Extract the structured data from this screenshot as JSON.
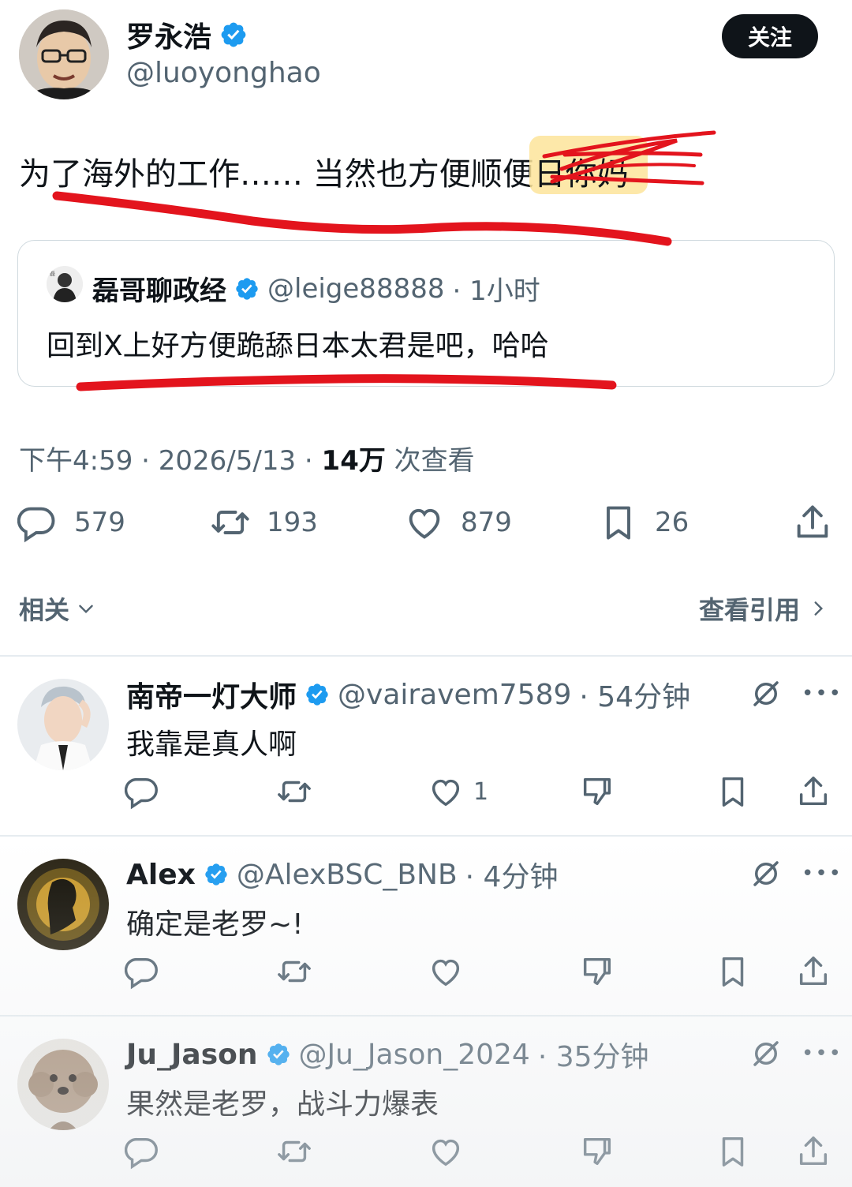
{
  "post": {
    "author_name": "罗永浩",
    "author_handle": "@luoyonghao",
    "follow_label": "关注",
    "text_main": "为了海外的工作…… 当然也方便顺便",
    "text_struck": "日你妈",
    "quote": {
      "name": "磊哥聊政经",
      "handle": "@leige88888",
      "time": "· 1小时",
      "text": "回到X上好方便跪舔日本太君是吧，哈哈"
    },
    "meta_time": "下午4:59 · 2026/5/13 · ",
    "meta_views_num": "14万",
    "meta_views_label": " 次查看",
    "stats": {
      "replies": "579",
      "reposts": "193",
      "likes": "879",
      "bookmarks": "26"
    }
  },
  "related": {
    "left_label": "相关",
    "right_label": "查看引用"
  },
  "replies": [
    {
      "name": "南帝一灯大师",
      "handle": "@vairavem7589",
      "time": "· 54分钟",
      "text": "我靠是真人啊",
      "likes": "1"
    },
    {
      "name": "Alex",
      "handle": "@AlexBSC_BNB",
      "time": "· 4分钟",
      "text": "确定是老罗~!",
      "likes": ""
    },
    {
      "name": "Ju_Jason",
      "handle": "@Ju_Jason_2024",
      "time": "· 35分钟",
      "text": "果然是老罗，战斗力爆表",
      "likes": ""
    }
  ],
  "colors": {
    "text_primary": "#0f1419",
    "text_secondary": "#536471",
    "verified_blue": "#1d9bf0",
    "annotation_red": "#e3141d",
    "highlight_yellow": "#fde49a"
  },
  "icons": [
    "verified-badge-icon",
    "reply-icon",
    "repost-icon",
    "like-icon",
    "bookmark-icon",
    "share-icon",
    "chevron-down-icon",
    "chevron-right-icon",
    "grok-icon",
    "more-icon",
    "dislike-icon"
  ]
}
